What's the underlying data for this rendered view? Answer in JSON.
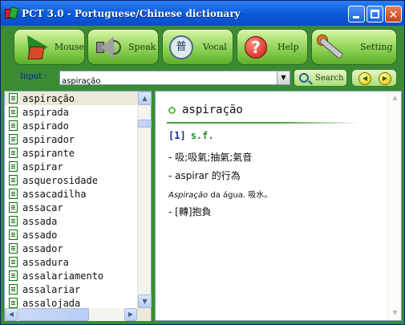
{
  "window": {
    "title": "PCT 3.0 - Portuguese/Chinese dictionary"
  },
  "toolbar": {
    "buttons": [
      {
        "label": "Mouse",
        "icon": "mouse-cursor-icon"
      },
      {
        "label": "Speak",
        "icon": "speaker-icon"
      },
      {
        "label": "Vocal",
        "icon": "vocal-icon"
      },
      {
        "label": "Help",
        "icon": "help-icon"
      },
      {
        "label": "Setting",
        "icon": "wrench-icon"
      }
    ],
    "vocal_icon_glyph": "普",
    "help_icon_glyph": "?"
  },
  "input": {
    "label": "Input :",
    "value": "aspiração",
    "search_label": "Search"
  },
  "word_list": {
    "items": [
      "aspiração",
      "aspirada",
      "aspirado",
      "aspirador",
      "aspirante",
      "aspirar",
      "asquerosidade",
      "assacadilha",
      "assacar",
      "assada",
      "assado",
      "assador",
      "assadura",
      "assalariamento",
      "assalariar",
      "assalojada"
    ],
    "selected_index": 0
  },
  "definition": {
    "headword": "aspiração",
    "sense_number": "[1]",
    "part_of_speech": "s.f.",
    "lines": [
      "- 吸;吸氣;抽氣;氣音",
      "- aspirar 的行為"
    ],
    "example_italic": "Aspiração",
    "example_rest": " da água. 吸水。",
    "line_last": "- [轉]抱負"
  },
  "colors": {
    "title_bar": "#0a58d8",
    "toolbar_bg": "#3a8b34",
    "button_green": "#8ed356",
    "sense_number": "#1a2a9a",
    "part_of_speech": "#2a8a2a"
  }
}
